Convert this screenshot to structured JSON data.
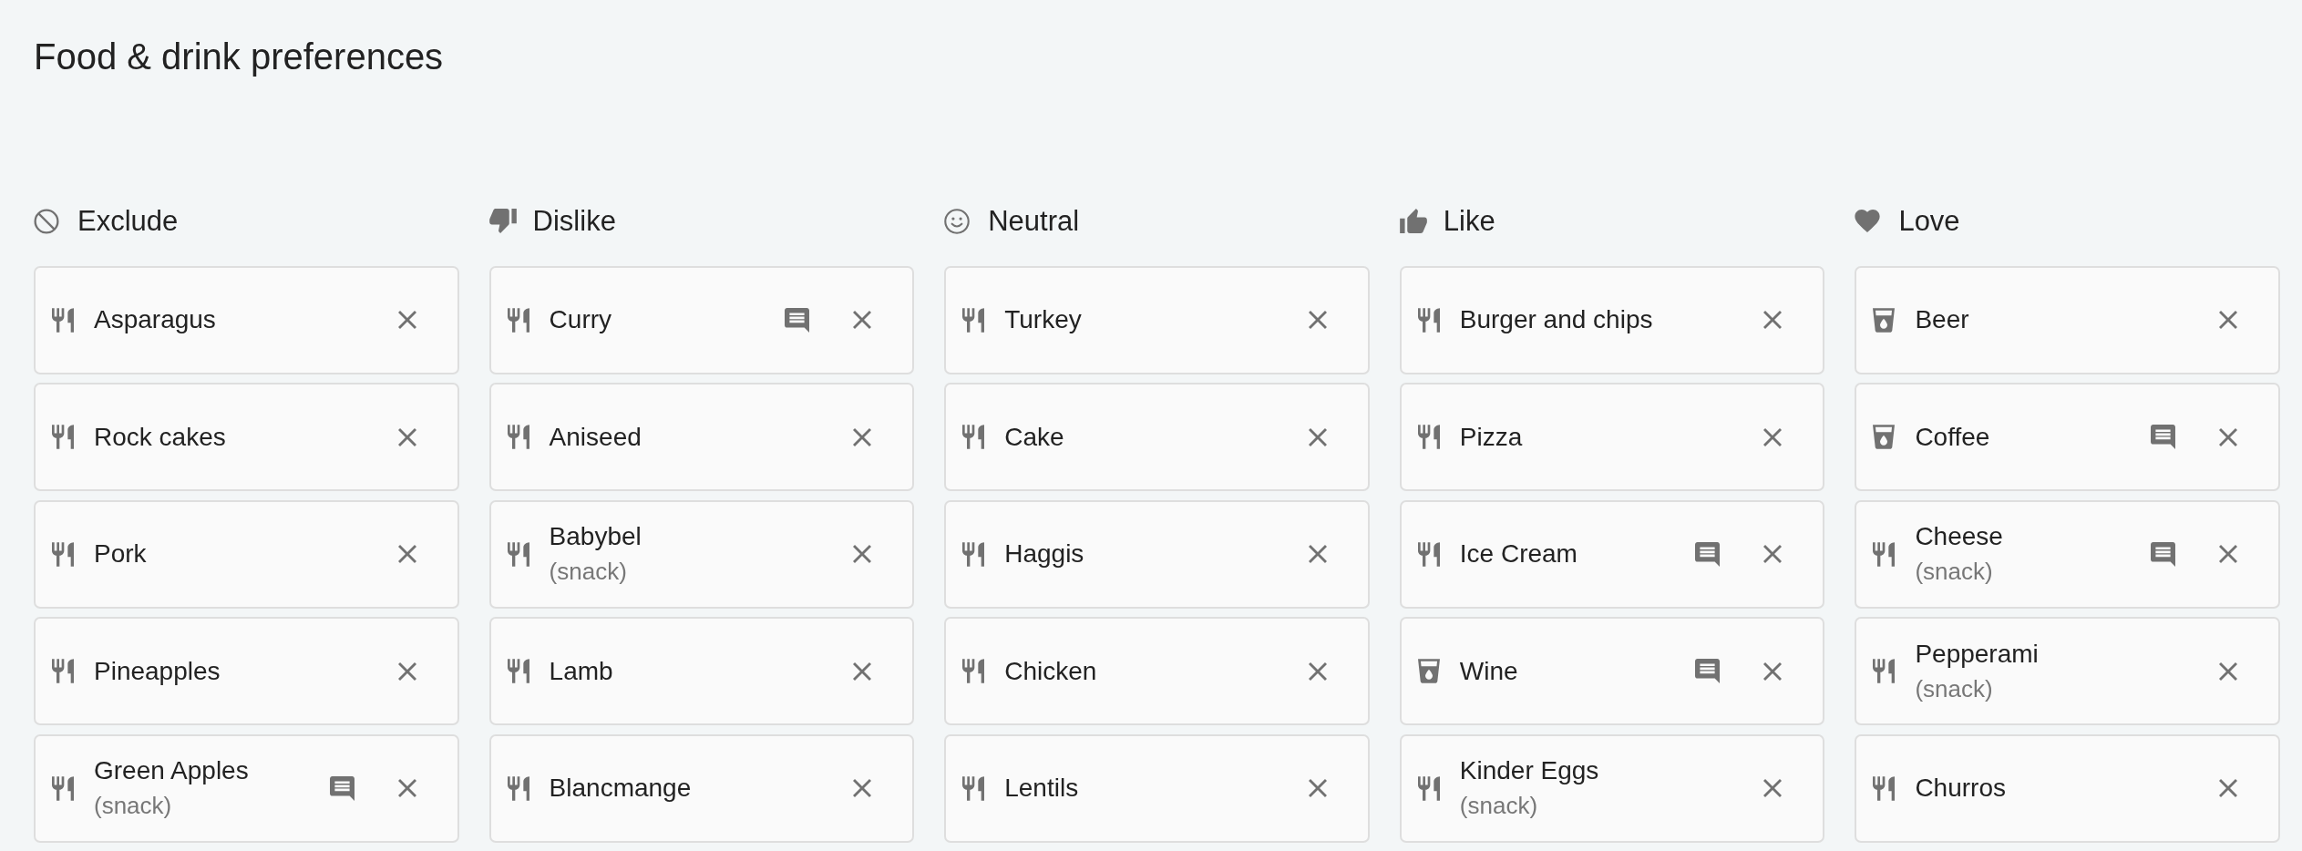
{
  "title": "Food & drink preferences",
  "columns": [
    {
      "kind": "exclude",
      "label": "Exclude",
      "items": [
        {
          "kind": "food",
          "name": "Asparagus",
          "comment": false
        },
        {
          "kind": "food",
          "name": "Rock cakes",
          "comment": false
        },
        {
          "kind": "food",
          "name": "Pork",
          "comment": false
        },
        {
          "kind": "food",
          "name": "Pineapples",
          "comment": false
        },
        {
          "kind": "food",
          "name": "Green Apples",
          "detail": "(snack)",
          "comment": true
        }
      ]
    },
    {
      "kind": "dislike",
      "label": "Dislike",
      "items": [
        {
          "kind": "food",
          "name": "Curry",
          "comment": true
        },
        {
          "kind": "food",
          "name": "Aniseed",
          "comment": false
        },
        {
          "kind": "food",
          "name": "Babybel",
          "detail": "(snack)",
          "comment": false
        },
        {
          "kind": "food",
          "name": "Lamb",
          "comment": false
        },
        {
          "kind": "food",
          "name": "Blancmange",
          "comment": false
        }
      ]
    },
    {
      "kind": "neutral",
      "label": "Neutral",
      "items": [
        {
          "kind": "food",
          "name": "Turkey",
          "comment": false
        },
        {
          "kind": "food",
          "name": "Cake",
          "comment": false
        },
        {
          "kind": "food",
          "name": "Haggis",
          "comment": false
        },
        {
          "kind": "food",
          "name": "Chicken",
          "comment": false
        },
        {
          "kind": "food",
          "name": "Lentils",
          "comment": false
        }
      ]
    },
    {
      "kind": "like",
      "label": "Like",
      "items": [
        {
          "kind": "food",
          "name": "Burger and chips",
          "comment": false
        },
        {
          "kind": "food",
          "name": "Pizza",
          "comment": false
        },
        {
          "kind": "food",
          "name": "Ice Cream",
          "comment": true
        },
        {
          "kind": "drink",
          "name": "Wine",
          "comment": true
        },
        {
          "kind": "food",
          "name": "Kinder Eggs",
          "detail": "(snack)",
          "comment": false
        }
      ]
    },
    {
      "kind": "love",
      "label": "Love",
      "items": [
        {
          "kind": "drink",
          "name": "Beer",
          "comment": false
        },
        {
          "kind": "drink",
          "name": "Coffee",
          "comment": true
        },
        {
          "kind": "food",
          "name": "Cheese",
          "detail": "(snack)",
          "comment": true
        },
        {
          "kind": "food",
          "name": "Pepperami",
          "detail": "(snack)",
          "comment": false
        },
        {
          "kind": "food",
          "name": "Churros",
          "comment": false
        }
      ]
    }
  ]
}
